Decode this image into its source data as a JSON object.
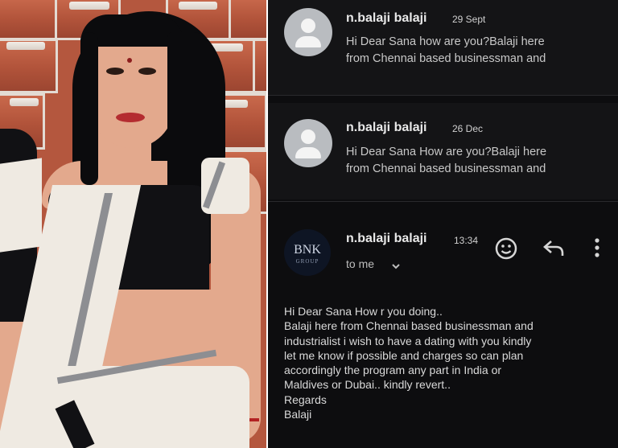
{
  "messages": [
    {
      "sender": "n.balaji balaji",
      "date": "29 Sept",
      "snippet_lines": [
        "Hi Dear Sana how are you?Balaji here",
        "from Chennai based businessman and"
      ]
    },
    {
      "sender": "n.balaji balaji",
      "date": "26 Dec",
      "snippet_lines": [
        "Hi Dear Sana How are you?Balaji here",
        "from Chennai based businessman and"
      ]
    }
  ],
  "open_message": {
    "sender": "n.balaji balaji",
    "time": "13:34",
    "recipient": "to me",
    "logo_text": "BNK",
    "logo_subtext": "GROUP",
    "body_lines": [
      "Hi Dear Sana How r you doing..",
      "Balaji here from Chennai based businessman and",
      "industrialist i wish to have a dating with you kindly",
      "let me know if possible and charges so can plan",
      "accordingly the program any part in India or",
      "Maldives or Dubai.. kindly revert..",
      "Regards",
      "Balaji"
    ]
  },
  "icons": [
    "avatar-placeholder-icon",
    "emoji-icon",
    "reply-icon",
    "more-vertical-icon",
    "chevron-down-icon"
  ],
  "colors": {
    "background": "#0d0d0f",
    "text": "#d9d9d9",
    "avatar": "#b9bcc0"
  }
}
